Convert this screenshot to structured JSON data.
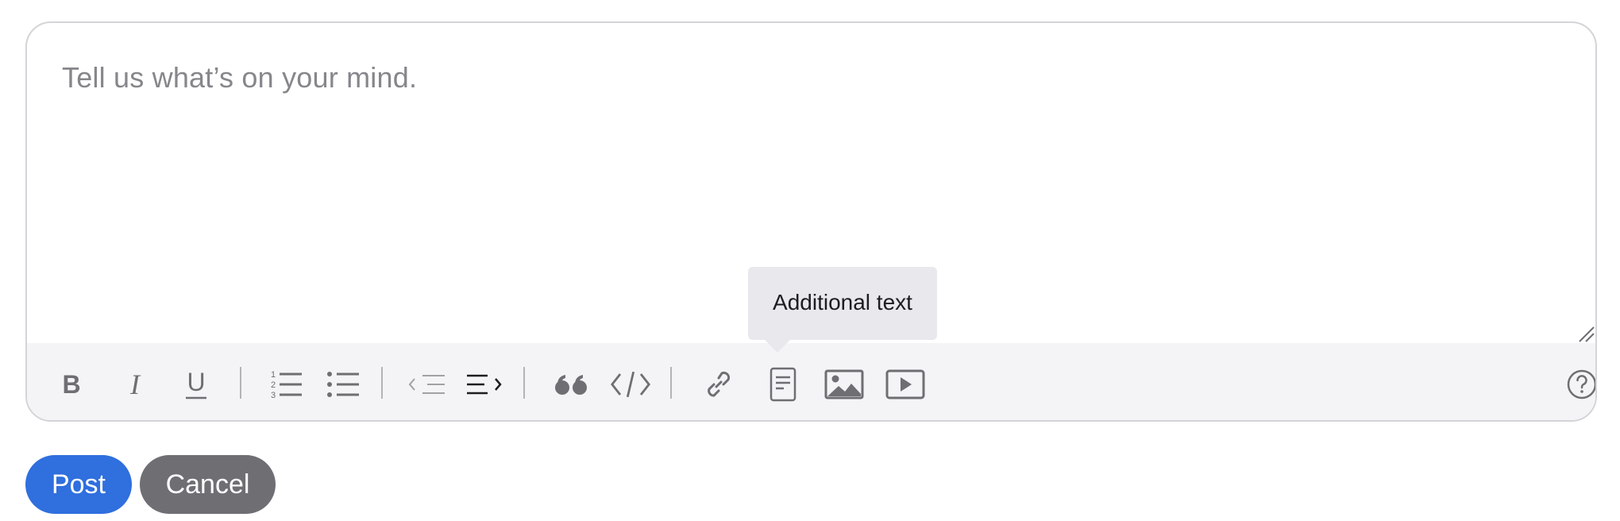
{
  "editor": {
    "placeholder": "Tell us what’s on your mind."
  },
  "toolbar": {
    "buttons": [
      {
        "name": "bold-icon",
        "label": "B"
      },
      {
        "name": "italic-icon",
        "label": "I"
      },
      {
        "name": "underline-icon",
        "label": "U"
      },
      {
        "name": "ordered-list-icon"
      },
      {
        "name": "bulleted-list-icon"
      },
      {
        "name": "outdent-icon"
      },
      {
        "name": "indent-icon"
      },
      {
        "name": "quote-icon"
      },
      {
        "name": "code-icon"
      },
      {
        "name": "link-icon"
      },
      {
        "name": "additional-text-icon"
      },
      {
        "name": "image-icon"
      },
      {
        "name": "video-icon"
      },
      {
        "name": "help-icon"
      }
    ],
    "tooltip": "Additional text"
  },
  "actions": {
    "post_label": "Post",
    "cancel_label": "Cancel"
  },
  "colors": {
    "post": "#2f6fde",
    "cancel": "#6e6e73",
    "toolbar_bg": "#f4f4f6",
    "icon": "#6e6e73"
  }
}
